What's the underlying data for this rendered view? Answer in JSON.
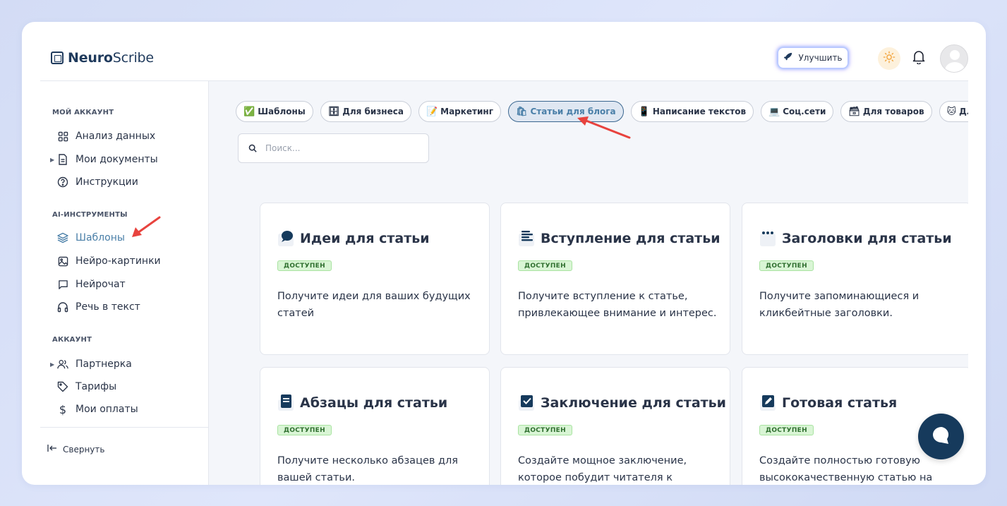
{
  "app": {
    "logo_bold": "Neuro",
    "logo_rest": "Scribe"
  },
  "header": {
    "upgrade_label": "Улучшить"
  },
  "sidebar": {
    "section_account": "МОЙ АККАУНТ",
    "item_analytics": "Анализ данных",
    "item_documents": "Мои документы",
    "item_instructions": "Инструкции",
    "section_ai": "AI-ИНСТРУМЕНТЫ",
    "item_templates": "Шаблоны",
    "item_images": "Нейро-картинки",
    "item_chat": "Нейрочат",
    "item_speech": "Речь в текст",
    "section_acc2": "АККАУНТ",
    "item_partner": "Партнерка",
    "item_tariffs": "Тарифы",
    "item_payments": "Мои оплаты",
    "collapse_label": "Свернуть"
  },
  "chips": [
    {
      "emoji": "✅",
      "label": "Шаблоны"
    },
    {
      "emoji": "🗄",
      "label": "Для бизнеса"
    },
    {
      "emoji": "📝",
      "label": "Маркетинг"
    },
    {
      "emoji": "🛍",
      "label": "Статьи для блога"
    },
    {
      "emoji": "📱",
      "label": "Написание текстов"
    },
    {
      "emoji": "💻",
      "label": "Соц.сети"
    },
    {
      "emoji": "🗃",
      "label": "Для товаров"
    },
    {
      "emoji": "🐱",
      "label": "Для сайта"
    }
  ],
  "search": {
    "placeholder": "Поиск..."
  },
  "cards": [
    {
      "title": "Идеи для статьи",
      "badge": "ДОСТУПЕН",
      "desc": "Получите идеи для ваших будущих статей"
    },
    {
      "title": "Вступление для статьи",
      "badge": "ДОСТУПЕН",
      "desc": "Получите вступление к статье, привлекающее внимание и интерес."
    },
    {
      "title": "Заголовки для статьи",
      "badge": "ДОСТУПЕН",
      "desc": "Получите запоминающиеся и кликбейтные заголовки."
    },
    {
      "title": "Абзацы для статьи",
      "badge": "ДОСТУПЕН",
      "desc": "Получите несколько абзацев для вашей статьи."
    },
    {
      "title": "Заключение для статьи",
      "badge": "ДОСТУПЕН",
      "desc": "Создайте мощное заключение, которое побудит читателя к"
    },
    {
      "title": "Готовая статья",
      "badge": "ДОСТУПЕН",
      "desc": "Создайте полностью готовую высококачественную статью на"
    }
  ],
  "colors": {
    "accent": "#4a7fa8",
    "brand_dark": "#163a5c",
    "badge_bg": "#d9f5d5",
    "arrow": "#e8433e"
  }
}
